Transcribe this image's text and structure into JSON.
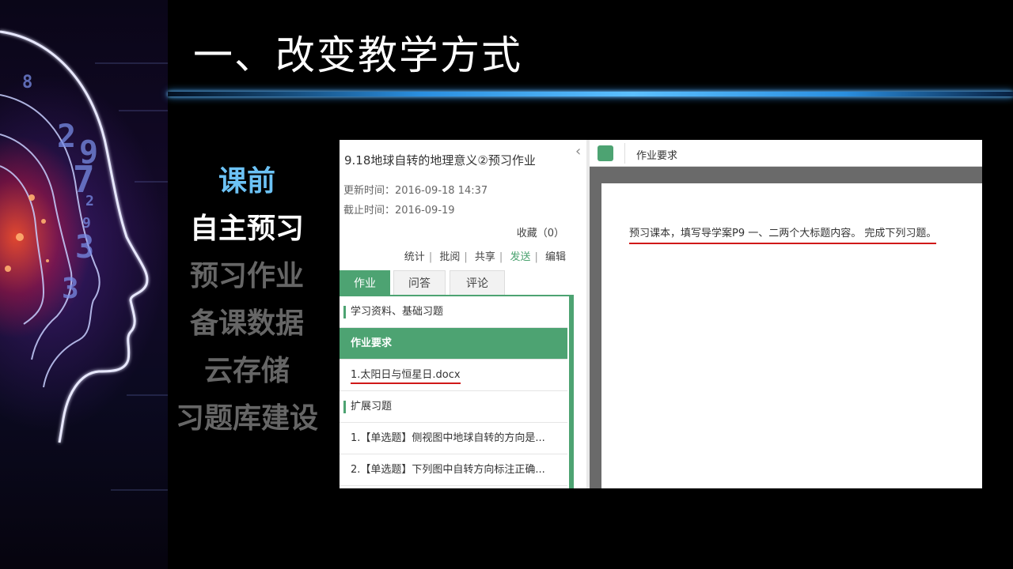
{
  "title": "一、改变教学方式",
  "menu": {
    "items": [
      {
        "label": "课前",
        "style": "blue"
      },
      {
        "label": "自主预习",
        "style": "white"
      },
      {
        "label": "预习作业",
        "style": "gray"
      },
      {
        "label": "备课数据",
        "style": "gray"
      },
      {
        "label": "云存储",
        "style": "gray"
      },
      {
        "label": "习题库建设",
        "style": "gray"
      }
    ]
  },
  "art_digits": [
    "8",
    "2",
    "9",
    "7",
    "2",
    "9",
    "3",
    "3"
  ],
  "left_panel": {
    "title": "9.18地球自转的地理意义②预习作业",
    "updated": "更新时间：2016-09-18 14:37",
    "deadline": "截止时间：2016-09-19",
    "favorite": "收藏（0）",
    "actions": [
      "统计",
      "批阅",
      "共享",
      "发送",
      "编辑"
    ],
    "tabs": [
      "作业",
      "问答",
      "评论"
    ],
    "list": [
      {
        "text": "学习资料、基础习题",
        "type": "section"
      },
      {
        "text": "作业要求",
        "type": "active"
      },
      {
        "text": "1.太阳日与恒星日.docx",
        "type": "file"
      },
      {
        "text": "扩展习题",
        "type": "section"
      },
      {
        "text": "1.【单选题】侧视图中地球自转的方向是...",
        "type": "item"
      },
      {
        "text": "2.【单选题】下列图中自转方向标注正确...",
        "type": "item"
      }
    ]
  },
  "right_panel": {
    "header": "作业要求",
    "content": "预习课本，填写导学案P9 一、二两个大标题内容。 完成下列习题。"
  },
  "colors": {
    "accent_green": "#4da372",
    "highlight_blue": "#6cc2f5",
    "underline_red": "#d01818"
  }
}
